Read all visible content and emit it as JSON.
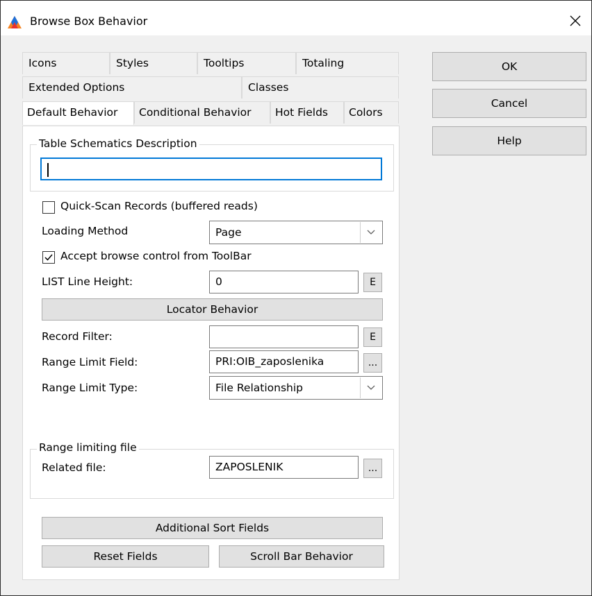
{
  "window": {
    "title": "Browse Box Behavior"
  },
  "tabs": {
    "row1": [
      "Icons",
      "Styles",
      "Tooltips",
      "Totaling"
    ],
    "row2": [
      "Extended Options",
      "Classes"
    ],
    "row3": [
      "Default Behavior",
      "Conditional Behavior",
      "Hot Fields",
      "Colors"
    ],
    "active": "Default Behavior"
  },
  "form": {
    "schematics_group": "Table Schematics Description",
    "schematics_value": "",
    "quick_scan_label": "Quick-Scan Records (buffered reads)",
    "quick_scan_checked": false,
    "loading_method_label": "Loading Method",
    "loading_method_value": "Page",
    "accept_toolbar_label": "Accept browse control from ToolBar",
    "accept_toolbar_checked": true,
    "list_line_height_label": "LIST Line Height:",
    "list_line_height_value": "0",
    "e_button": "E",
    "locator_button": "Locator Behavior",
    "record_filter_label": "Record Filter:",
    "record_filter_value": "",
    "range_limit_field_label": "Range Limit Field:",
    "range_limit_field_value": "PRI:OIB_zaposlenika",
    "ellipsis_button": "...",
    "range_limit_type_label": "Range Limit Type:",
    "range_limit_type_value": "File Relationship",
    "range_file_group": "Range limiting file",
    "related_file_label": "Related file:",
    "related_file_value": "ZAPOSLENIK",
    "additional_sort_button": "Additional Sort Fields",
    "reset_fields_button": "Reset Fields",
    "scroll_bar_button": "Scroll Bar Behavior"
  },
  "buttons": {
    "ok": "OK",
    "cancel": "Cancel",
    "help": "Help"
  },
  "colors": {
    "focus": "#0078d7",
    "button_face": "#e1e1e1",
    "dialog_bg": "#f0f0f0"
  }
}
